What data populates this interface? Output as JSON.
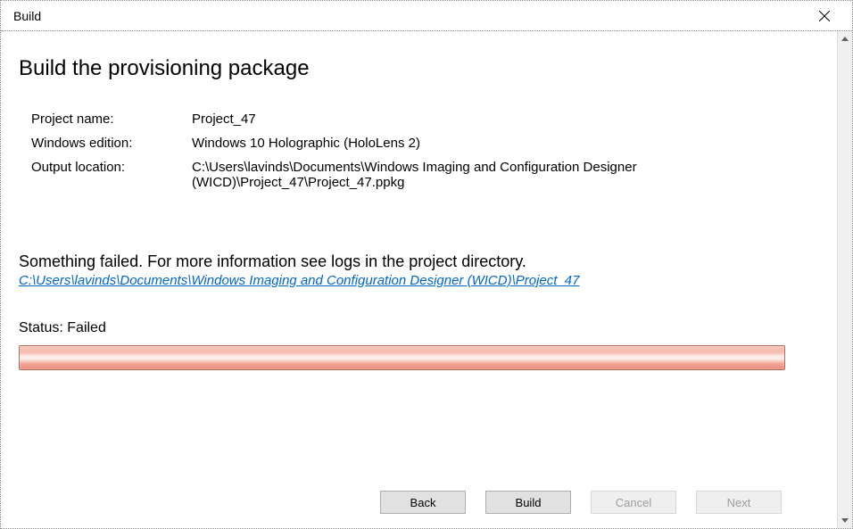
{
  "titlebar": {
    "title": "Build"
  },
  "page": {
    "title": "Build the provisioning package"
  },
  "info": {
    "project_name_label": "Project name:",
    "project_name_value": "Project_47",
    "windows_edition_label": "Windows edition:",
    "windows_edition_value": "Windows 10 Holographic (HoloLens 2)",
    "output_location_label": "Output location:",
    "output_location_value": "C:\\Users\\lavinds\\Documents\\Windows Imaging and Configuration Designer (WICD)\\Project_47\\Project_47.ppkg"
  },
  "error": {
    "message": "Something failed. For more information see logs in the project directory.",
    "link": "C:\\Users\\lavinds\\Documents\\Windows Imaging and Configuration Designer (WICD)\\Project_47"
  },
  "status": {
    "label": "Status:",
    "value": "Failed"
  },
  "buttons": {
    "back": "Back",
    "build": "Build",
    "cancel": "Cancel",
    "next": "Next"
  }
}
